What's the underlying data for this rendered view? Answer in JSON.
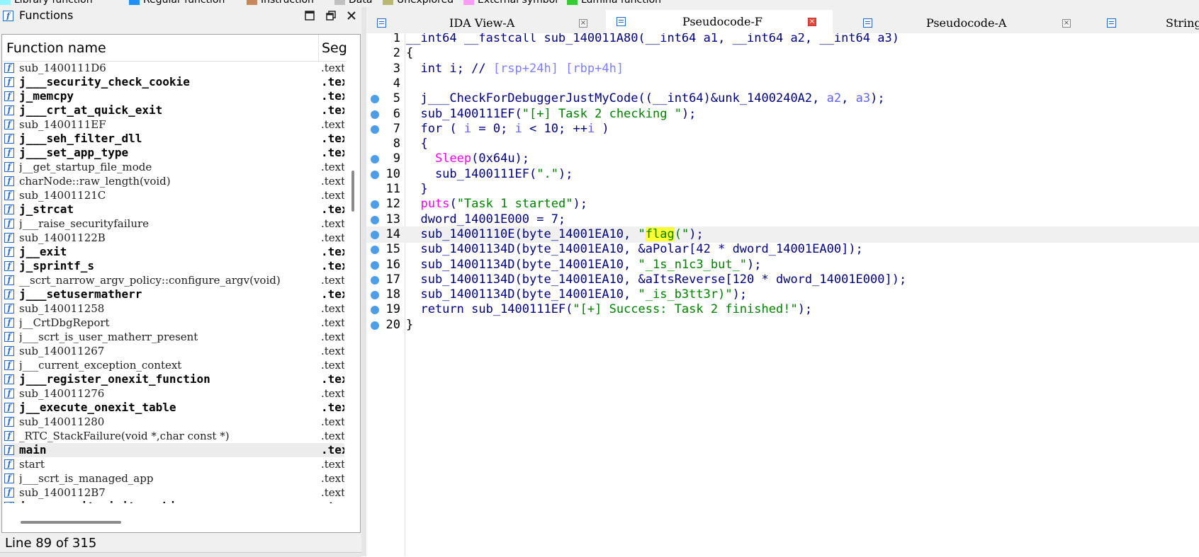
{
  "legend": {
    "items": [
      {
        "label": "Library function",
        "color": "#8ff5ff"
      },
      {
        "label": "Regular function",
        "color": "#1e90ff"
      },
      {
        "label": "Instruction",
        "color": "#c8865a"
      },
      {
        "label": "Data",
        "color": "#c0c0c0"
      },
      {
        "label": "Unexplored",
        "color": "#b8b870"
      },
      {
        "label": "External symbol",
        "color": "#ff9bff"
      },
      {
        "label": "Lumina function",
        "color": "#33cc33"
      }
    ]
  },
  "functions_panel": {
    "title": "Functions",
    "col_name": "Function name",
    "col_segment": "Seg",
    "rows": [
      {
        "name": "sub_1400111D6",
        "seg": ".text",
        "bold": false
      },
      {
        "name": "j___security_check_cookie",
        "seg": ".text",
        "bold": true
      },
      {
        "name": "j_memcpy",
        "seg": ".text",
        "bold": true
      },
      {
        "name": "j___crt_at_quick_exit",
        "seg": ".text",
        "bold": true
      },
      {
        "name": "sub_1400111EF",
        "seg": ".text",
        "bold": false
      },
      {
        "name": "j___seh_filter_dll",
        "seg": ".text",
        "bold": true
      },
      {
        "name": "j___set_app_type",
        "seg": ".text",
        "bold": true
      },
      {
        "name": "j__get_startup_file_mode",
        "seg": ".text",
        "bold": false
      },
      {
        "name": "charNode::raw_length(void)",
        "seg": ".text",
        "bold": false
      },
      {
        "name": "sub_14001121C",
        "seg": ".text",
        "bold": false
      },
      {
        "name": "j_strcat",
        "seg": ".text",
        "bold": true
      },
      {
        "name": "j___raise_securityfailure",
        "seg": ".text",
        "bold": false
      },
      {
        "name": "sub_14001122B",
        "seg": ".text",
        "bold": false
      },
      {
        "name": "j__exit",
        "seg": ".text",
        "bold": true
      },
      {
        "name": "j_sprintf_s",
        "seg": ".text",
        "bold": true
      },
      {
        "name": "__scrt_narrow_argv_policy::configure_argv(void)",
        "seg": ".text",
        "bold": false
      },
      {
        "name": "j___setusermatherr",
        "seg": ".text",
        "bold": true
      },
      {
        "name": "sub_140011258",
        "seg": ".text",
        "bold": false
      },
      {
        "name": "j__CrtDbgReport",
        "seg": ".text",
        "bold": false
      },
      {
        "name": "j___scrt_is_user_matherr_present",
        "seg": ".text",
        "bold": false
      },
      {
        "name": "sub_140011267",
        "seg": ".text",
        "bold": false
      },
      {
        "name": "j___current_exception_context",
        "seg": ".text",
        "bold": false
      },
      {
        "name": "j___register_onexit_function",
        "seg": ".text",
        "bold": true
      },
      {
        "name": "sub_140011276",
        "seg": ".text",
        "bold": false
      },
      {
        "name": "j__execute_onexit_table",
        "seg": ".text",
        "bold": true
      },
      {
        "name": "sub_140011280",
        "seg": ".text",
        "bold": false
      },
      {
        "name": "_RTC_StackFailure(void *,char const *)",
        "seg": ".text",
        "bold": false
      },
      {
        "name": "main",
        "seg": ".text",
        "bold": true,
        "selected": true
      },
      {
        "name": "start",
        "seg": ".text",
        "bold": false
      },
      {
        "name": "j___scrt_is_managed_app",
        "seg": ".text",
        "bold": false
      },
      {
        "name": "sub_1400112B7",
        "seg": ".text",
        "bold": false
      },
      {
        "name": "j___security_init_cookie",
        "seg": ".text",
        "bold": true
      }
    ],
    "status": "Line 89 of 315"
  },
  "tabs": [
    {
      "label": "IDA View-A",
      "active": false
    },
    {
      "label": "Pseudocode-F",
      "active": true
    },
    {
      "label": "Pseudocode-A",
      "active": false
    },
    {
      "label": "Strings",
      "active": false
    }
  ],
  "editor": {
    "highlight_line": 14,
    "lines": [
      {
        "n": "1",
        "bp": false,
        "spans": [
          [
            "__int64 __fastcall sub_140011A80(__int64 a1, __int64 a2, __int64 a3)",
            ""
          ]
        ]
      },
      {
        "n": "2",
        "bp": false,
        "spans": [
          [
            "{",
            "k-lbr"
          ]
        ]
      },
      {
        "n": "3",
        "bp": false,
        "spans": [
          [
            "  int i; // ",
            ""
          ],
          [
            "[rsp+24h] [rbp+4h]",
            "k-com"
          ]
        ]
      },
      {
        "n": "4",
        "bp": false,
        "spans": [
          [
            "",
            ""
          ]
        ]
      },
      {
        "n": "5",
        "bp": true,
        "spans": [
          [
            "  j___CheckForDebuggerJustMyCode((__int64)&unk_1400240A2, ",
            ""
          ],
          [
            "a2",
            "k-arg"
          ],
          [
            ", ",
            ""
          ],
          [
            "a3",
            "k-arg"
          ],
          [
            ");",
            ""
          ]
        ]
      },
      {
        "n": "6",
        "bp": true,
        "spans": [
          [
            "  sub_1400111EF(",
            ""
          ],
          [
            "\"[+] Task 2 checking \"",
            "k-str"
          ],
          [
            ");",
            ""
          ]
        ]
      },
      {
        "n": "7",
        "bp": true,
        "spans": [
          [
            "  for ( ",
            ""
          ],
          [
            "i",
            "k-arg"
          ],
          [
            " = 0; ",
            ""
          ],
          [
            "i",
            "k-arg"
          ],
          [
            " < 10; ++",
            ""
          ],
          [
            "i",
            "k-arg"
          ],
          [
            " )",
            ""
          ]
        ]
      },
      {
        "n": "8",
        "bp": false,
        "spans": [
          [
            "  {",
            ""
          ]
        ]
      },
      {
        "n": "9",
        "bp": true,
        "spans": [
          [
            "    ",
            ""
          ],
          [
            "Sleep",
            "k-imp"
          ],
          [
            "(0x64u);",
            ""
          ]
        ]
      },
      {
        "n": "10",
        "bp": true,
        "spans": [
          [
            "    sub_1400111EF(",
            ""
          ],
          [
            "\".\"",
            "k-str"
          ],
          [
            ");",
            ""
          ]
        ]
      },
      {
        "n": "11",
        "bp": false,
        "spans": [
          [
            "  }",
            ""
          ]
        ]
      },
      {
        "n": "12",
        "bp": true,
        "spans": [
          [
            "  ",
            ""
          ],
          [
            "puts",
            "k-imp"
          ],
          [
            "(",
            ""
          ],
          [
            "\"Task 1 started\"",
            "k-str"
          ],
          [
            ");",
            ""
          ]
        ]
      },
      {
        "n": "13",
        "bp": true,
        "spans": [
          [
            "  dword_14001E000 = 7;",
            ""
          ]
        ]
      },
      {
        "n": "14",
        "bp": true,
        "spans": [
          [
            "  sub_14001110E(byte_14001EA10, ",
            ""
          ],
          [
            "\"",
            "k-str"
          ],
          [
            "flag",
            "k-str k-hl"
          ],
          [
            "(\"",
            "k-str"
          ],
          [
            ");",
            ""
          ]
        ]
      },
      {
        "n": "15",
        "bp": true,
        "spans": [
          [
            "  sub_14001134D(byte_14001EA10, &aPolar[42 * dword_14001EA00]);",
            ""
          ]
        ]
      },
      {
        "n": "16",
        "bp": true,
        "spans": [
          [
            "  sub_14001134D(byte_14001EA10, ",
            ""
          ],
          [
            "\"_1s_n1c3_but_\"",
            "k-str"
          ],
          [
            ");",
            ""
          ]
        ]
      },
      {
        "n": "17",
        "bp": true,
        "spans": [
          [
            "  sub_14001134D(byte_14001EA10, &aItsReverse[120 * dword_14001E000]);",
            ""
          ]
        ]
      },
      {
        "n": "18",
        "bp": true,
        "spans": [
          [
            "  sub_14001134D(byte_14001EA10, ",
            ""
          ],
          [
            "\"_is_b3tt3r)\"",
            "k-str"
          ],
          [
            ");",
            ""
          ]
        ]
      },
      {
        "n": "19",
        "bp": true,
        "spans": [
          [
            "  return sub_1400111EF(",
            ""
          ],
          [
            "\"[+] Success: Task 2 finished!\"",
            "k-str"
          ],
          [
            ");",
            ""
          ]
        ]
      },
      {
        "n": "20",
        "bp": true,
        "spans": [
          [
            "}",
            "k-lbr"
          ]
        ]
      }
    ]
  },
  "icons": {
    "panel_title": "function-icon",
    "maximize": "maximize-icon",
    "restore": "restore-icon",
    "close": "close-icon",
    "breakpoint": "breakpoint-dot-icon"
  },
  "colors": {
    "breakpoint": "#4f9de6",
    "string": "#008000",
    "comment": "#7f7fff",
    "import": "#ff00ff",
    "highlight": "#ffff33",
    "tab_close_active": "#e04a3a"
  }
}
